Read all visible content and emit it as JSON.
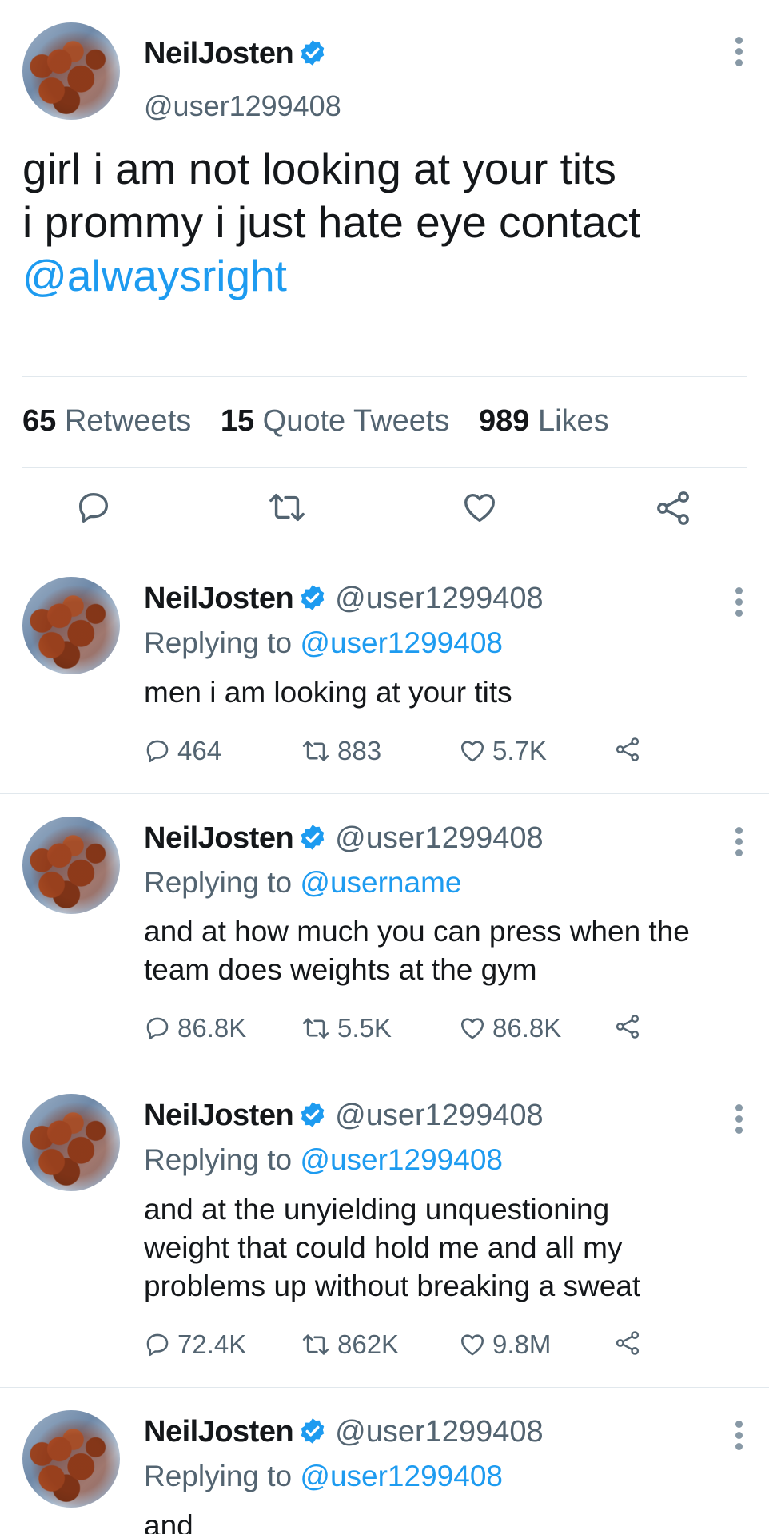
{
  "main_tweet": {
    "name": "NeilJosten",
    "handle": "@user1299408",
    "text_lines": [
      "girl i am not looking at your tits",
      "i prommy i just hate eye contact"
    ],
    "mention": "@alwaysright",
    "stats": {
      "retweets_count": "65",
      "retweets_label": "Retweets",
      "quotes_count": "15",
      "quotes_label": "Quote Tweets",
      "likes_count": "989",
      "likes_label": "Likes"
    },
    "icons": [
      "reply-icon",
      "retweet-icon",
      "like-icon",
      "share-icon"
    ]
  },
  "replies": [
    {
      "name": "NeilJosten",
      "handle": "@user1299408",
      "replying_label": "Replying to",
      "replying_to": "@user1299408",
      "text_lines": [
        "men i am looking at your tits"
      ],
      "replies": "464",
      "retweets": "883",
      "likes": "5.7K"
    },
    {
      "name": "NeilJosten",
      "handle": "@user1299408",
      "replying_label": "Replying to",
      "replying_to": "@username",
      "text_lines": [
        "and at how much you can press when the",
        "team does weights at the gym"
      ],
      "replies": "86.8K",
      "retweets": "5.5K",
      "likes": "86.8K"
    },
    {
      "name": "NeilJosten",
      "handle": "@user1299408",
      "replying_label": "Replying to",
      "replying_to": "@user1299408",
      "text_lines": [
        "and at the unyielding unquestioning",
        "weight that could hold me and all my",
        "problems up without breaking a sweat"
      ],
      "replies": "72.4K",
      "retweets": "862K",
      "likes": "9.8M"
    },
    {
      "name": "NeilJosten",
      "handle": "@user1299408",
      "replying_label": "Replying to",
      "replying_to": "@user1299408",
      "text_lines": [
        "and"
      ]
    }
  ],
  "colors": {
    "accent": "#1d9bf0",
    "muted": "#536471",
    "text": "#14171a",
    "divider": "#e1e8ed"
  }
}
